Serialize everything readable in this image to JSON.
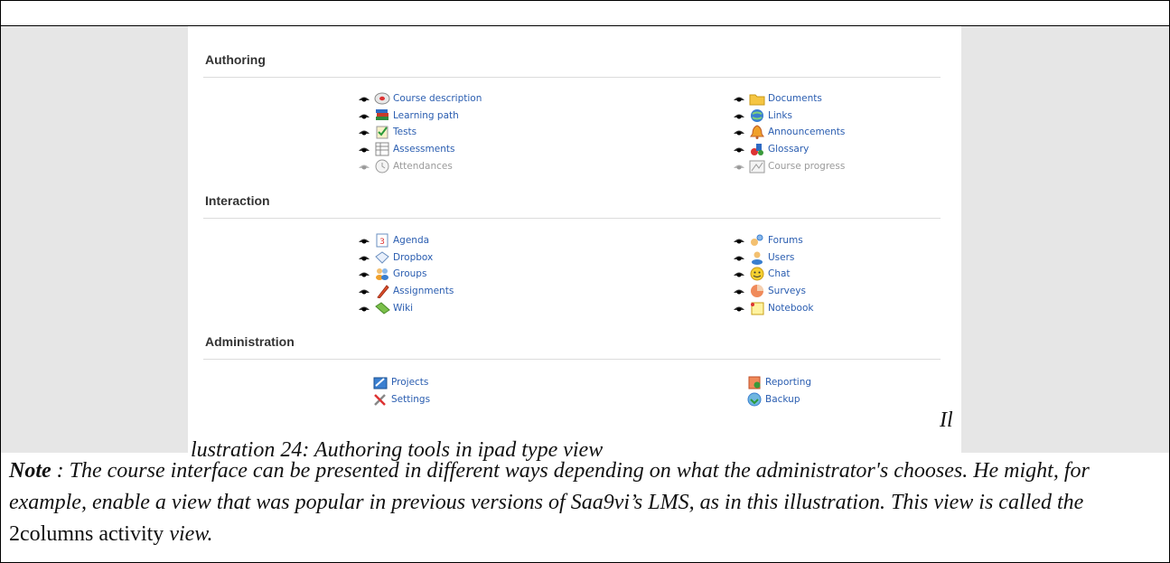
{
  "sections": [
    {
      "title": "Authoring",
      "left": [
        {
          "label": "Course description",
          "icon": "course-description-icon",
          "disabled": false
        },
        {
          "label": "Learning path",
          "icon": "learning-path-icon",
          "disabled": false
        },
        {
          "label": "Tests",
          "icon": "tests-icon",
          "disabled": false
        },
        {
          "label": "Assessments",
          "icon": "assessments-icon",
          "disabled": false
        },
        {
          "label": "Attendances",
          "icon": "attendances-icon",
          "disabled": true
        }
      ],
      "right": [
        {
          "label": "Documents",
          "icon": "documents-folder-icon",
          "disabled": false
        },
        {
          "label": "Links",
          "icon": "links-globe-icon",
          "disabled": false
        },
        {
          "label": "Announcements",
          "icon": "announcements-bell-icon",
          "disabled": false
        },
        {
          "label": "Glossary",
          "icon": "glossary-icon",
          "disabled": false
        },
        {
          "label": "Course progress",
          "icon": "course-progress-icon",
          "disabled": true
        }
      ]
    },
    {
      "title": "Interaction",
      "left": [
        {
          "label": "Agenda",
          "icon": "agenda-calendar-icon",
          "disabled": false
        },
        {
          "label": "Dropbox",
          "icon": "dropbox-icon",
          "disabled": false
        },
        {
          "label": "Groups",
          "icon": "groups-icon",
          "disabled": false
        },
        {
          "label": "Assignments",
          "icon": "assignments-pen-icon",
          "disabled": false
        },
        {
          "label": "Wiki",
          "icon": "wiki-icon",
          "disabled": false
        }
      ],
      "right": [
        {
          "label": "Forums",
          "icon": "forums-icon",
          "disabled": false
        },
        {
          "label": "Users",
          "icon": "users-icon",
          "disabled": false
        },
        {
          "label": "Chat",
          "icon": "chat-smiley-icon",
          "disabled": false
        },
        {
          "label": "Surveys",
          "icon": "surveys-pie-icon",
          "disabled": false
        },
        {
          "label": "Notebook",
          "icon": "notebook-icon",
          "disabled": false
        }
      ]
    },
    {
      "title": "Administration",
      "left": [
        {
          "label": "Projects",
          "icon": "projects-icon"
        },
        {
          "label": "Settings",
          "icon": "settings-tools-icon"
        }
      ],
      "right": [
        {
          "label": "Reporting",
          "icon": "reporting-icon"
        },
        {
          "label": "Backup",
          "icon": "backup-icon"
        }
      ]
    }
  ],
  "caption": {
    "part1": "Il",
    "part2": "lustration 24: Authoring tools in ipad type view"
  },
  "note": {
    "label": "Note",
    "text1": " : The course interface can be presented in different ways depending on what the administrator's chooses. He might, for example, enable a view that was popular in previous versions of Saa9vi’s LMS, as in this illustration. This view is called the ",
    "upright1": "2columns",
    "text2": " activity ",
    "text3": "view."
  },
  "colors": {
    "link": "#2a5db0",
    "disabled": "#9a9a9a",
    "background_gray": "#e6e6e6"
  }
}
